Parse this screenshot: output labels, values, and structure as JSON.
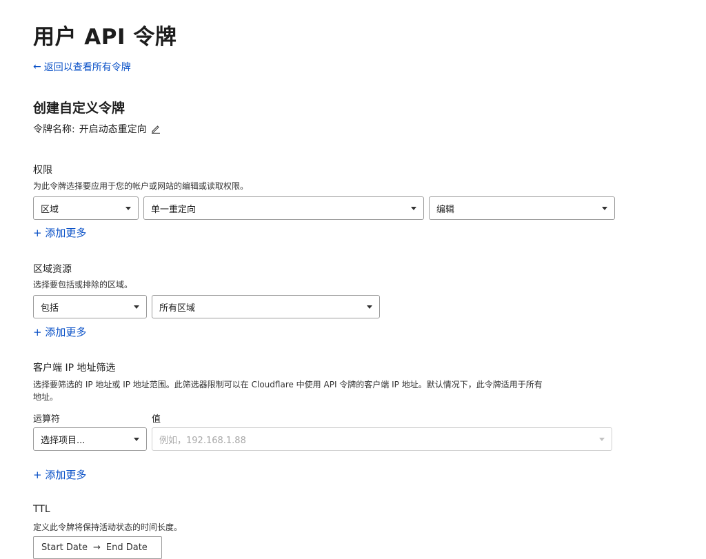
{
  "page": {
    "title": "用户 API 令牌",
    "back_link": "返回以查看所有令牌"
  },
  "form": {
    "section_title": "创建自定义令牌",
    "token_name_label": "令牌名称: ",
    "token_name_value": "开启动态重定向"
  },
  "permissions": {
    "label": "权限",
    "description": "为此令牌选择要应用于您的帐户或网站的编辑或读取权限。",
    "selects": [
      "区域",
      "单一重定向",
      "编辑"
    ],
    "add_more": "+ 添加更多"
  },
  "zone_resources": {
    "label": "区域资源",
    "description": "选择要包括或排除的区域。",
    "selects": [
      "包括",
      "所有区域"
    ],
    "add_more": "+ 添加更多"
  },
  "ip_filter": {
    "label": "客户端 IP 地址筛选",
    "description_line1": "选择要筛选的 IP 地址或 IP 地址范围。此筛选器限制可以在 Cloudflare 中使用 API 令牌的客户端 IP 地址。默认情况下，此令牌适用于所有",
    "description_line2": "地址。",
    "operator_label": "运算符",
    "value_label": "值",
    "operator_select": "选择项目...",
    "value_placeholder": "例如，192.168.1.88",
    "add_more": "+ 添加更多"
  },
  "ttl": {
    "label": "TTL",
    "description": "定义此令牌将保持活动状态的时间长度。",
    "start": "Start Date",
    "arrow": "→",
    "end": "End Date"
  },
  "colors": {
    "link": "#0a51c7",
    "border": "#9b9b9b"
  }
}
